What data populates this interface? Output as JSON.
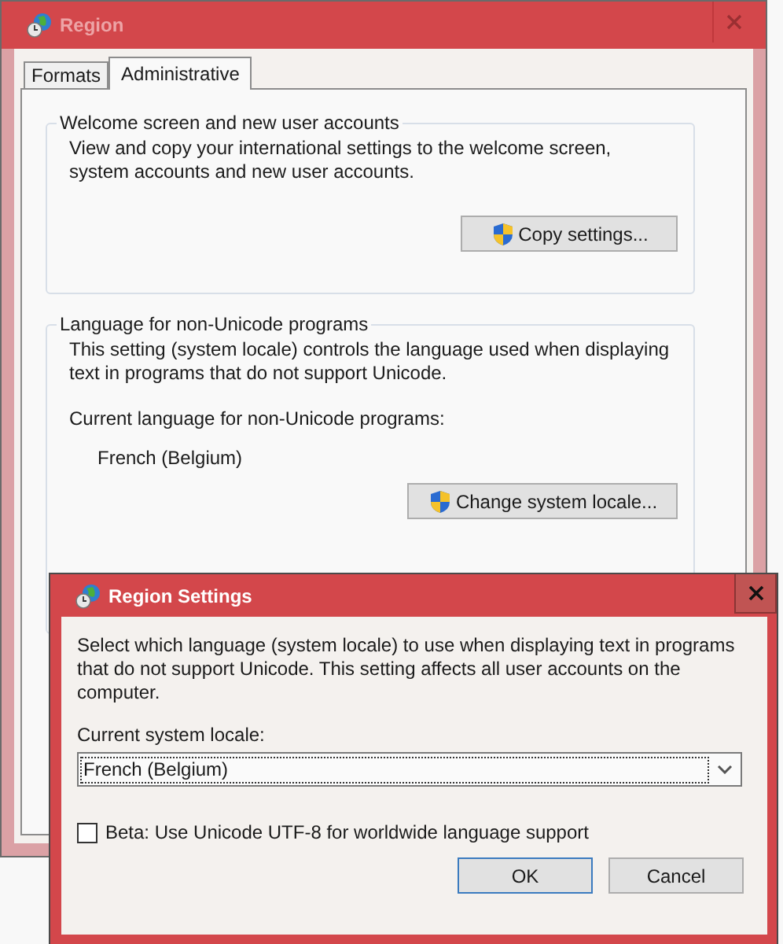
{
  "main_window": {
    "title": "Region",
    "tabs": [
      {
        "label": "Formats",
        "selected": false
      },
      {
        "label": "Administrative",
        "selected": true
      }
    ],
    "welcome_group": {
      "title": "Welcome screen and new user accounts",
      "text": "View and copy your international settings to the welcome screen, system accounts and new user accounts.",
      "button": "Copy settings..."
    },
    "language_group": {
      "title": "Language for non-Unicode programs",
      "text": "This setting (system locale) controls the language used when displaying text in programs that do not support Unicode.",
      "current_label": "Current language for non-Unicode programs:",
      "current_value": "French (Belgium)",
      "button": "Change system locale..."
    }
  },
  "dialog": {
    "title": "Region Settings",
    "text": "Select which language (system locale) to use when displaying text in programs that do not support Unicode. This setting affects all user accounts on the computer.",
    "locale_label": "Current system locale:",
    "locale_value": "French (Belgium)",
    "beta_checkbox": {
      "label": "Beta: Use Unicode UTF-8 for worldwide language support",
      "checked": false
    },
    "buttons": [
      "OK",
      "Cancel"
    ]
  }
}
